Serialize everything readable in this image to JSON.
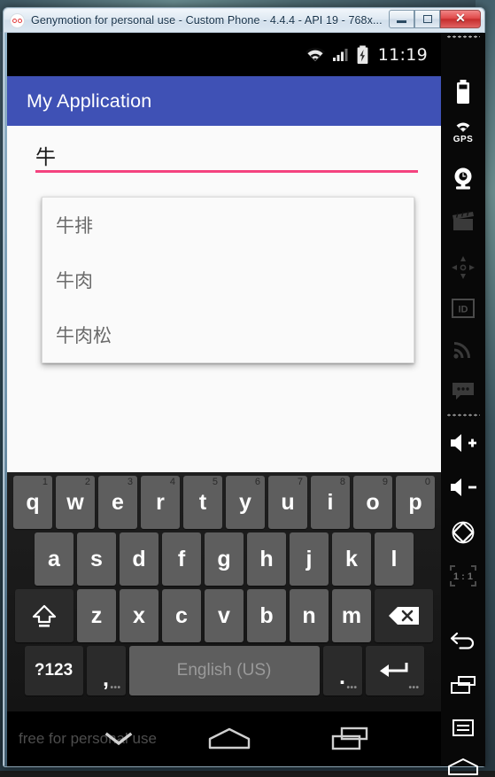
{
  "window": {
    "title": "Genymotion for personal use - Custom Phone - 4.4.4 - API 19 - 768x...",
    "logo_icon": "genymotion-logo-icon",
    "buttons": {
      "minimize": {
        "icon": "minimize-icon",
        "label": ""
      },
      "maximize": {
        "icon": "restore-icon",
        "label": ""
      },
      "close": {
        "icon": "close-icon",
        "label": "✕"
      }
    }
  },
  "android": {
    "statusbar": {
      "wifi_icon": "wifi-icon",
      "signal_icon": "cellular-signal-icon",
      "battery_icon": "battery-charging-icon",
      "clock": "11:19"
    },
    "appbar": {
      "title": "My Application",
      "color": "#3f51b5"
    },
    "content": {
      "input": {
        "value": "牛",
        "placeholder": "",
        "underline_color": "#f4437f"
      },
      "suggestions": [
        {
          "label": "牛排"
        },
        {
          "label": "牛肉"
        },
        {
          "label": "牛肉松"
        }
      ]
    },
    "keyboard": {
      "row1": [
        {
          "key": "q",
          "hint": "1"
        },
        {
          "key": "w",
          "hint": "2"
        },
        {
          "key": "e",
          "hint": "3"
        },
        {
          "key": "r",
          "hint": "4"
        },
        {
          "key": "t",
          "hint": "5"
        },
        {
          "key": "y",
          "hint": "6"
        },
        {
          "key": "u",
          "hint": "7"
        },
        {
          "key": "i",
          "hint": "8"
        },
        {
          "key": "o",
          "hint": "9"
        },
        {
          "key": "p",
          "hint": "0"
        }
      ],
      "row2": [
        {
          "key": "a"
        },
        {
          "key": "s"
        },
        {
          "key": "d"
        },
        {
          "key": "f"
        },
        {
          "key": "g"
        },
        {
          "key": "h"
        },
        {
          "key": "j"
        },
        {
          "key": "k"
        },
        {
          "key": "l"
        }
      ],
      "row3": [
        {
          "key": "z"
        },
        {
          "key": "x"
        },
        {
          "key": "c"
        },
        {
          "key": "v"
        },
        {
          "key": "b"
        },
        {
          "key": "n"
        },
        {
          "key": "m"
        }
      ],
      "shift_icon": "shift-key-icon",
      "backspace_icon": "backspace-key-icon",
      "symbols_label": "?123",
      "comma_label": ",",
      "space_label": "English (US)",
      "period_label": ".",
      "enter_icon": "enter-key-icon",
      "more_dots": "•••"
    },
    "navbar": {
      "watermark": "free for personal use",
      "back_icon": "keyboard-hide-icon",
      "home_icon": "home-icon",
      "recents_icon": "recents-icon"
    }
  },
  "sidebar": {
    "items": [
      {
        "icon": "battery-icon",
        "label": "Battery"
      },
      {
        "icon": "gps-icon",
        "label": "GPS"
      },
      {
        "icon": "camera-icon",
        "label": "Camera"
      },
      {
        "icon": "clapperboard-icon",
        "label": "Video"
      },
      {
        "icon": "dpad-icon",
        "label": "Controls"
      },
      {
        "icon": "identifiers-icon",
        "label": "ID"
      },
      {
        "icon": "network-icon",
        "label": "Network"
      },
      {
        "icon": "sms-icon",
        "label": "SMS"
      },
      {
        "icon": "volume-up-icon",
        "label": "Volume up"
      },
      {
        "icon": "volume-down-icon",
        "label": "Volume down"
      },
      {
        "icon": "rotate-icon",
        "label": "Rotate"
      },
      {
        "icon": "scale-one-to-one-icon",
        "label": "1 : 1"
      },
      {
        "icon": "back-icon",
        "label": "Back"
      },
      {
        "icon": "recents-icon",
        "label": "Recents"
      },
      {
        "icon": "menu-icon",
        "label": "Menu"
      },
      {
        "icon": "home-icon",
        "label": "Home"
      },
      {
        "icon": "collapse-chevron-icon",
        "label": "Collapse"
      }
    ],
    "scale_label": "1 : 1"
  }
}
